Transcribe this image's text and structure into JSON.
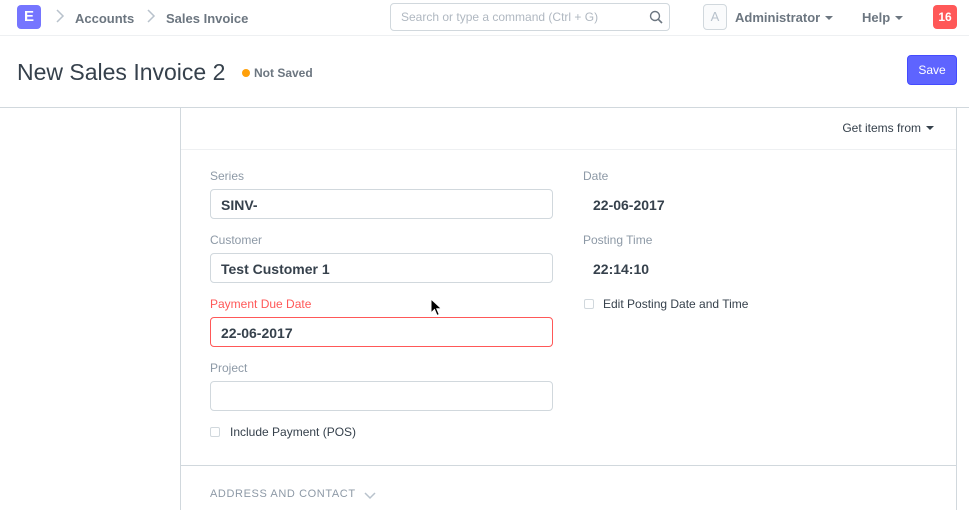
{
  "navbar": {
    "logo_letter": "E",
    "breadcrumbs": [
      {
        "label": "Accounts"
      },
      {
        "label": "Sales Invoice"
      }
    ],
    "search_placeholder": "Search or type a command (Ctrl + G)",
    "user_initial": "A",
    "user_name": "Administrator",
    "help_label": "Help",
    "notification_count": "16"
  },
  "page": {
    "title": "New Sales Invoice 2",
    "status": "Not Saved",
    "save_label": "Save"
  },
  "form": {
    "get_items_label": "Get items from",
    "series": {
      "label": "Series",
      "value": "SINV-"
    },
    "customer": {
      "label": "Customer",
      "value": "Test Customer 1"
    },
    "payment_due_date": {
      "label": "Payment Due Date",
      "value": "22-06-2017"
    },
    "project": {
      "label": "Project",
      "value": ""
    },
    "include_payment": {
      "label": "Include Payment (POS)",
      "checked": false
    },
    "date": {
      "label": "Date",
      "value": "22-06-2017"
    },
    "posting_time": {
      "label": "Posting Time",
      "value": "22:14:10"
    },
    "edit_posting": {
      "label": "Edit Posting Date and Time",
      "checked": false
    },
    "section_address": "ADDRESS AND CONTACT"
  },
  "colors": {
    "accent": "#5e64ff",
    "logo": "#7575ff",
    "error": "#ff5858",
    "status_dot": "#ffa00a"
  }
}
